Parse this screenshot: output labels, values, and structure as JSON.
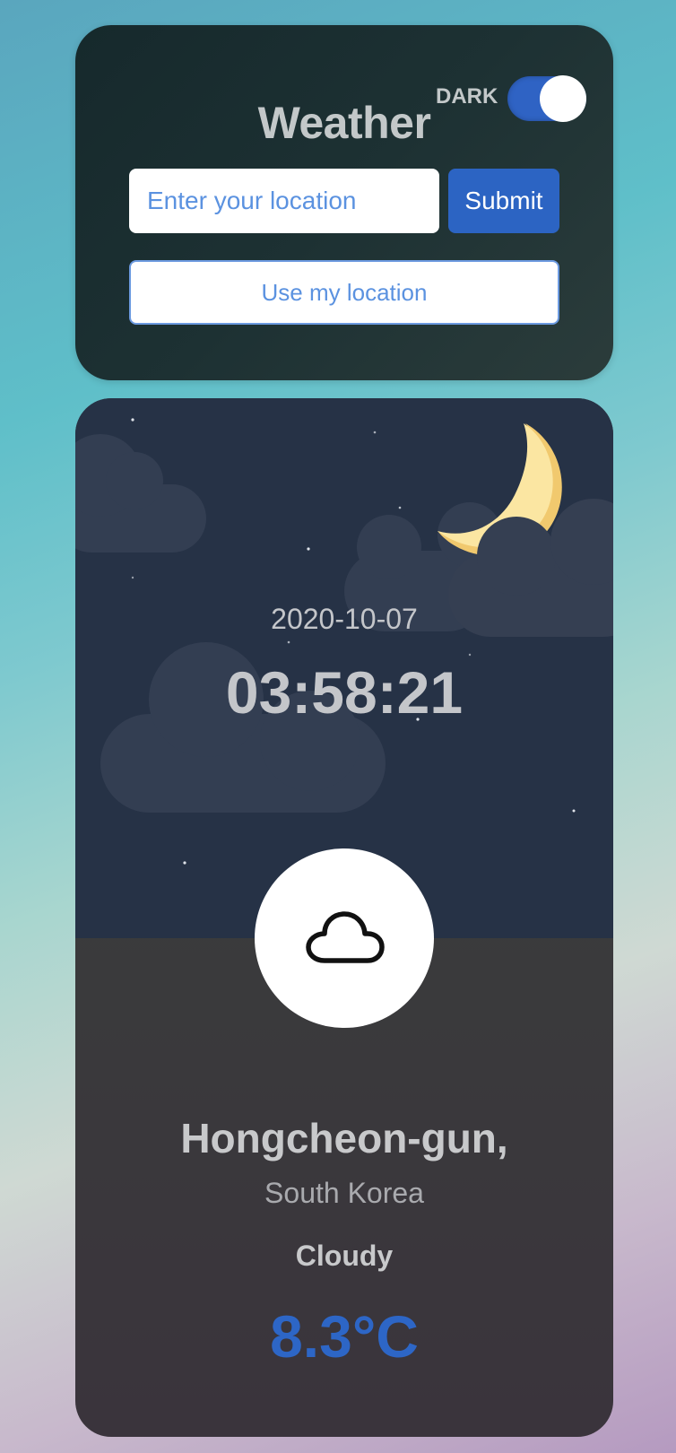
{
  "header": {
    "title": "Weather",
    "theme_label": "DARK",
    "theme_toggle_on": true
  },
  "search": {
    "placeholder": "Enter your location",
    "value": "",
    "submit_label": "Submit",
    "geo_label": "Use my location"
  },
  "weather": {
    "date": "2020-10-07",
    "time": "03:58:21",
    "city": "Hongcheon-gun,",
    "country": "South Korea",
    "condition": "Cloudy",
    "temperature": "8.3°C",
    "icon": "cloud-icon",
    "scene": "night-moon-clouds-stars"
  },
  "colors": {
    "accent": "#2c64c3",
    "sky": "#263246",
    "card_dark": "#1d3133",
    "moon": "#f9e29c",
    "cloud": "#343f52"
  }
}
